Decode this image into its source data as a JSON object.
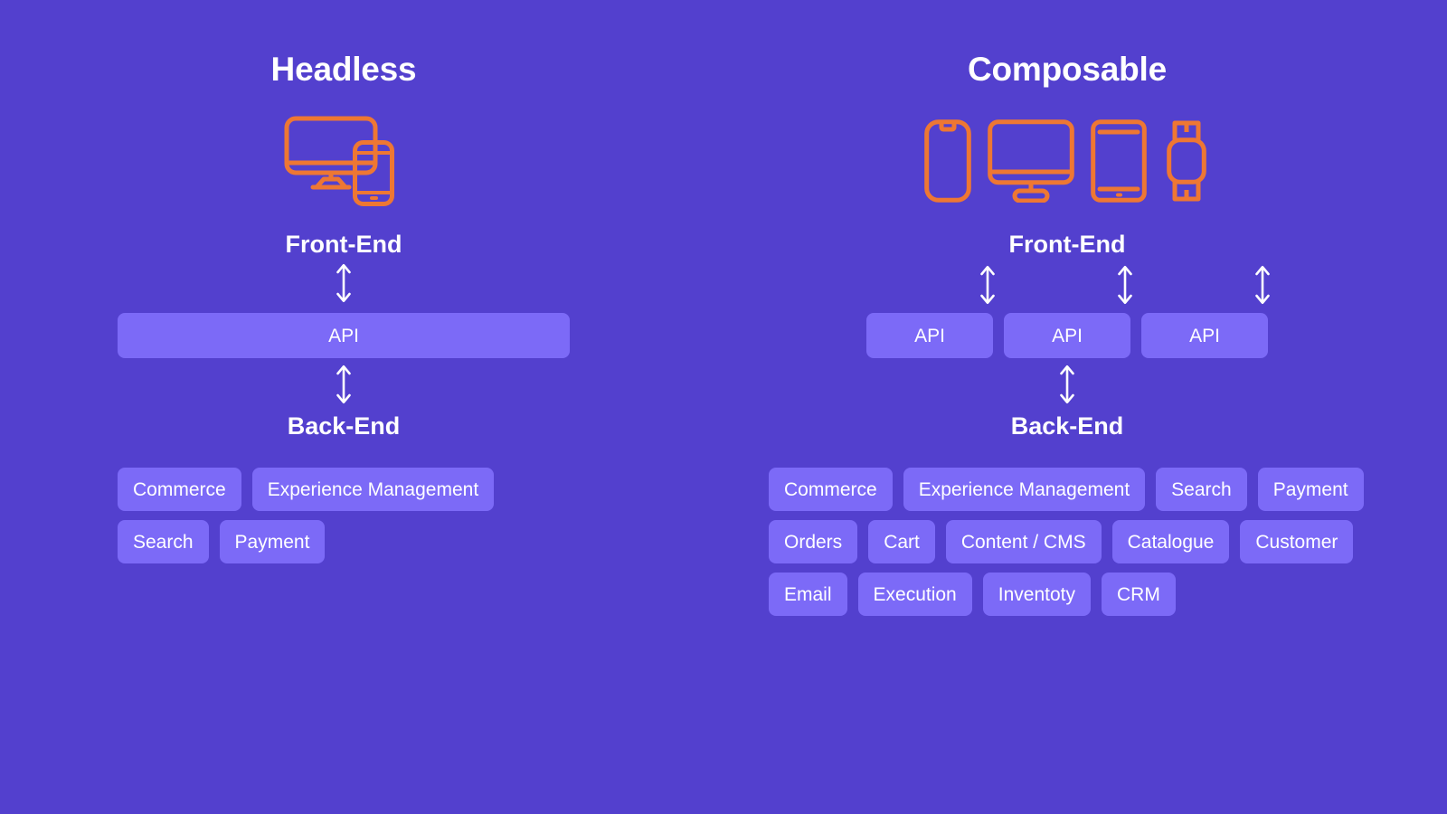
{
  "theme": {
    "background": "#5340CE",
    "chip": "#7C6AF7",
    "accent_orange": "#EE7733",
    "text": "#FFFFFF"
  },
  "headless": {
    "title": "Headless",
    "devices": [
      "desktop-monitor-icon",
      "mobile-phone-icon"
    ],
    "front_end_label": "Front-End",
    "api_label": "API",
    "back_end_label": "Back-End",
    "tags": [
      "Commerce",
      "Experience Management",
      "Search",
      "Payment"
    ]
  },
  "composable": {
    "title": "Composable",
    "devices": [
      "mobile-phone-icon",
      "desktop-monitor-icon",
      "tablet-icon",
      "smartwatch-icon"
    ],
    "front_end_label": "Front-End",
    "api_labels": [
      "API",
      "API",
      "API"
    ],
    "back_end_label": "Back-End",
    "tags": [
      "Commerce",
      "Experience Management",
      "Search",
      "Payment",
      "Orders",
      "Cart",
      "Content / CMS",
      "Catalogue",
      "Customer",
      "Email",
      "Execution",
      "Inventoty",
      "CRM"
    ]
  }
}
